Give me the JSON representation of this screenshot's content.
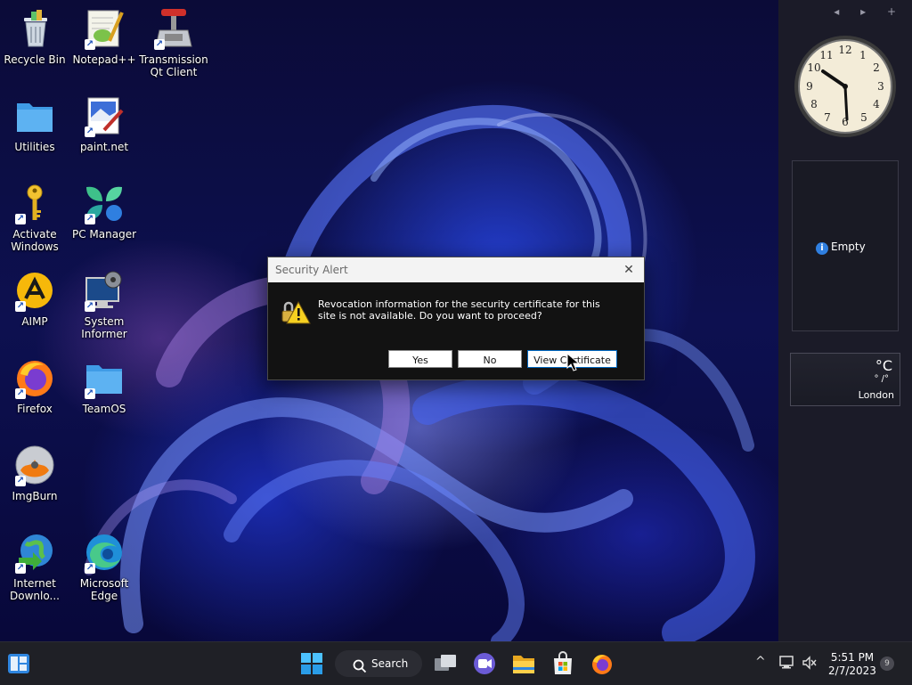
{
  "desktop": {
    "icons": [
      {
        "label": "Recycle Bin"
      },
      {
        "label": "Notepad++"
      },
      {
        "label": "Transmission Qt Client"
      },
      {
        "label": "Utilities"
      },
      {
        "label": "paint.net"
      },
      {
        "label": "Activate Windows"
      },
      {
        "label": "PC Manager"
      },
      {
        "label": "AIMP"
      },
      {
        "label": "System Informer"
      },
      {
        "label": "Firefox"
      },
      {
        "label": "TeamOS"
      },
      {
        "label": "ImgBurn"
      },
      {
        "label": "Internet Downlo..."
      },
      {
        "label": "Microsoft Edge"
      }
    ]
  },
  "sidebar": {
    "controls": "◂ ▸ +",
    "slideshow": {
      "info_icon": "i",
      "text": "Empty"
    },
    "weather": {
      "unit": "°C",
      "range": "° /°",
      "city": "London"
    }
  },
  "dialog": {
    "title": "Security Alert",
    "close_glyph": "✕",
    "message": "Revocation information for the security certificate for this site is not available. Do you want to proceed?",
    "yes_label": "Yes",
    "no_label": "No",
    "view_label": "View Certificate"
  },
  "taskbar": {
    "search_label": "Search",
    "time": "5:51 PM",
    "date": "2/7/2023",
    "notification_count": "9",
    "chevron": "^"
  },
  "colors": {
    "accent": "#0067c0",
    "taskbar_bg": "#1f2026",
    "sidebar_bg": "#1b1b28"
  }
}
